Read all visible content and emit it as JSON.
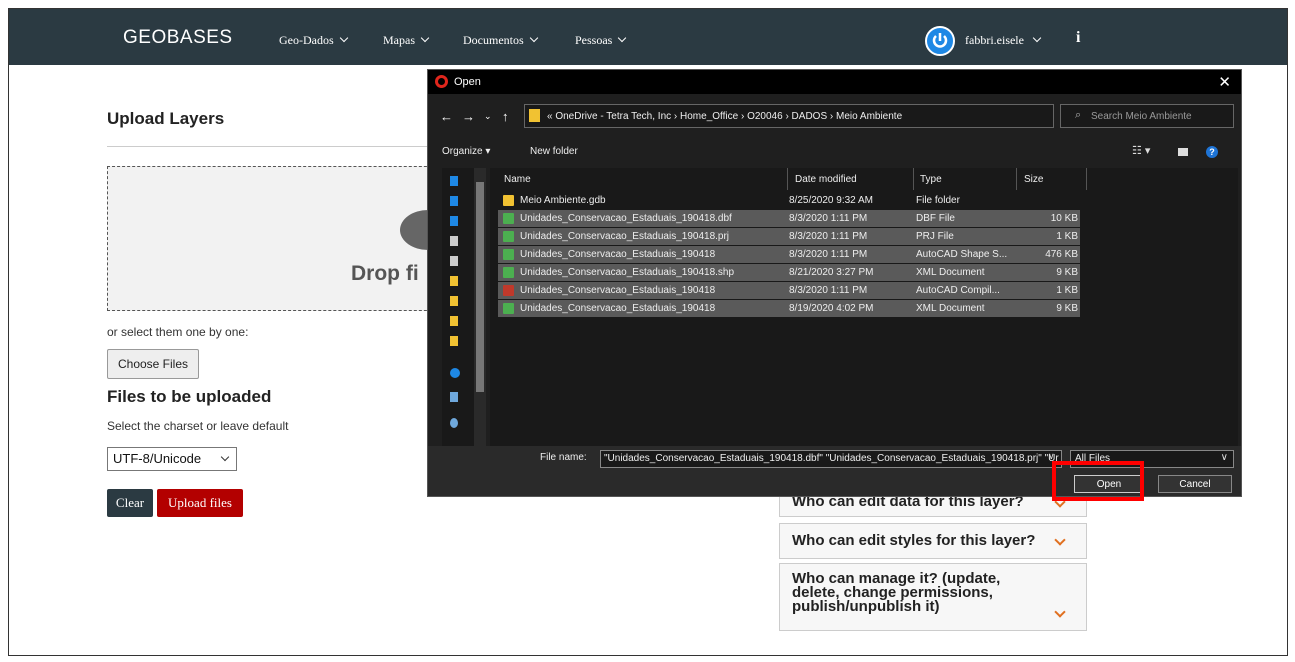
{
  "navbar": {
    "brand": "GEOBASES",
    "menu": [
      "Geo-Dados",
      "Mapas",
      "Documentos",
      "Pessoas"
    ],
    "user": "fabbri.eisele",
    "info": "i"
  },
  "upload": {
    "title": "Upload Layers",
    "drop_text": "Drop fi",
    "select_one": "or select them one by one:",
    "choose_label": "Choose Files",
    "files_title": "Files to be uploaded",
    "charset_label": "Select the charset or leave default",
    "charset_value": "UTF-8/Unicode",
    "clear_label": "Clear",
    "upload_label": "Upload files"
  },
  "accordion": [
    "Who can edit data for this layer?",
    "Who can edit styles for this layer?",
    "Who can manage it? (update, delete, change permissions, publish/unpublish it)"
  ],
  "dialog": {
    "title": "Open",
    "address": "« OneDrive - Tetra Tech, Inc  ›  Home_Office  ›  O20046  ›  DADOS  ›  Meio Ambiente",
    "search_placeholder": "Search Meio Ambiente",
    "organize": "Organize ▾",
    "new_folder": "New folder",
    "columns": [
      "Name",
      "Date modified",
      "Type",
      "Size"
    ],
    "files": [
      {
        "name": "Meio Ambiente.gdb",
        "date": "8/25/2020 9:32 AM",
        "type": "File folder",
        "size": "",
        "icon": "folder",
        "selected": false
      },
      {
        "name": "Unidades_Conservacao_Estaduais_190418.dbf",
        "date": "8/3/2020 1:11 PM",
        "type": "DBF File",
        "size": "10 KB",
        "icon": "file",
        "selected": true
      },
      {
        "name": "Unidades_Conservacao_Estaduais_190418.prj",
        "date": "8/3/2020 1:11 PM",
        "type": "PRJ File",
        "size": "1 KB",
        "icon": "file",
        "selected": true
      },
      {
        "name": "Unidades_Conservacao_Estaduais_190418",
        "date": "8/3/2020 1:11 PM",
        "type": "AutoCAD Shape S...",
        "size": "476 KB",
        "icon": "file",
        "selected": true
      },
      {
        "name": "Unidades_Conservacao_Estaduais_190418.shp",
        "date": "8/21/2020 3:27 PM",
        "type": "XML Document",
        "size": "9 KB",
        "icon": "file",
        "selected": true
      },
      {
        "name": "Unidades_Conservacao_Estaduais_190418",
        "date": "8/3/2020 1:11 PM",
        "type": "AutoCAD Compil...",
        "size": "1 KB",
        "icon": "red",
        "selected": true
      },
      {
        "name": "Unidades_Conservacao_Estaduais_190418",
        "date": "8/19/2020 4:02 PM",
        "type": "XML Document",
        "size": "9 KB",
        "icon": "file",
        "selected": true
      }
    ],
    "file_name_label": "File name:",
    "file_name_value": "\"Unidades_Conservacao_Estaduais_190418.dbf\" \"Unidades_Conservacao_Estaduais_190418.prj\" \"Ur",
    "filter": "All Files",
    "open_label": "Open",
    "cancel_label": "Cancel"
  }
}
